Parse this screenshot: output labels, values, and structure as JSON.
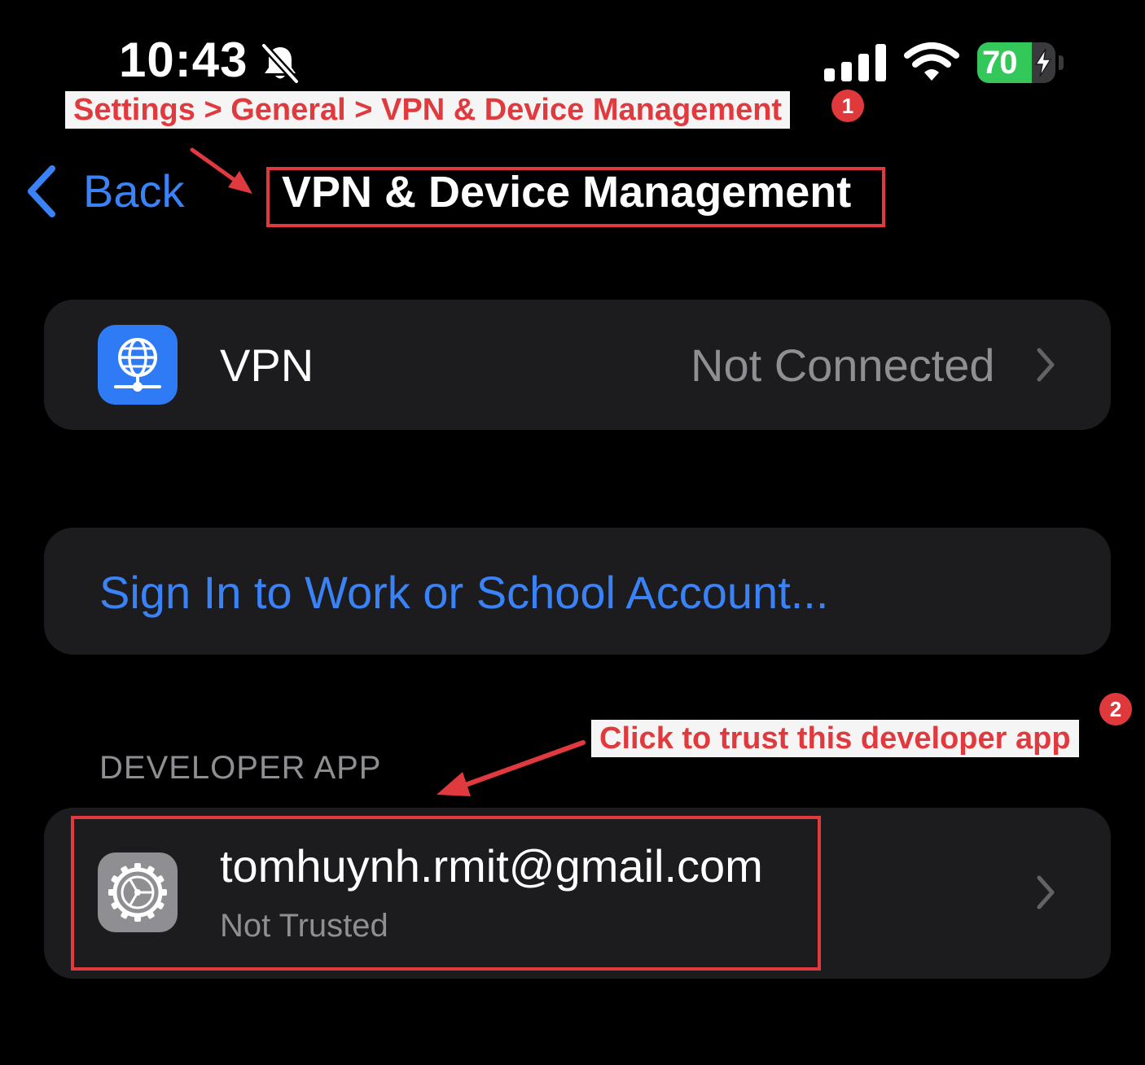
{
  "status_bar": {
    "time": "10:43",
    "battery_level": "70",
    "icons": [
      "bell-slash-icon",
      "cellular-signal-icon",
      "wifi-icon",
      "battery-charging-icon"
    ]
  },
  "annotations": {
    "step1_text": "Settings > General > VPN & Device Management",
    "step1_number": "1",
    "step2_text": "Click to trust this developer app",
    "step2_number": "2",
    "color": "#e03a3e"
  },
  "nav": {
    "back_label": "Back",
    "title": "VPN & Device Management"
  },
  "vpn": {
    "label": "VPN",
    "status": "Not Connected",
    "icon": "globe-network-icon"
  },
  "account": {
    "sign_in_label": "Sign In to Work or School Account..."
  },
  "developer_app": {
    "section_header": "DEVELOPER APP",
    "email": "tomhuynh.rmit@gmail.com",
    "status": "Not Trusted",
    "icon": "settings-gear-icon"
  },
  "colors": {
    "accent": "#3a82f7",
    "background": "#000000",
    "group_background": "#1c1c1e",
    "secondary_text": "#8e8e93",
    "battery_green": "#34c759"
  }
}
